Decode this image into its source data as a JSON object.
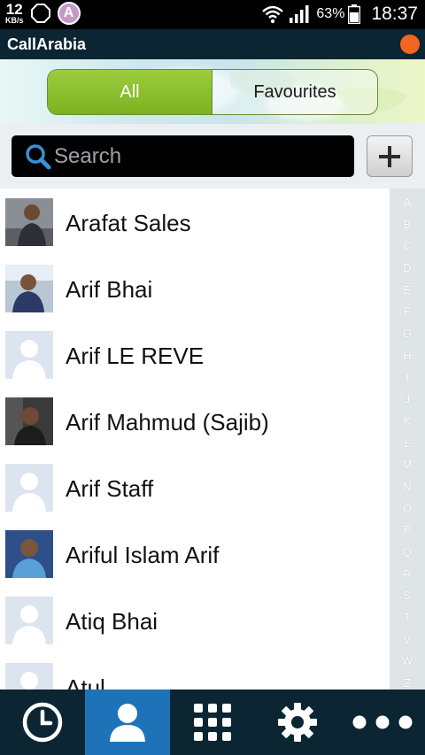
{
  "status_bar": {
    "net_speed_value": "12",
    "net_speed_unit": "KB/s",
    "notification_letter": "A",
    "battery_percent": "63%",
    "time": "18:37"
  },
  "app": {
    "title": "CallArabia"
  },
  "tabs": {
    "all_label": "All",
    "favourites_label": "Favourites",
    "active": "All"
  },
  "search": {
    "placeholder": "Search",
    "value": ""
  },
  "add_button": {
    "icon": "plus-icon"
  },
  "contacts": [
    {
      "name": "Arafat Sales",
      "avatar": "photo"
    },
    {
      "name": "Arif Bhai",
      "avatar": "photo"
    },
    {
      "name": "Arif LE REVE",
      "avatar": "placeholder"
    },
    {
      "name": "Arif Mahmud (Sajib)",
      "avatar": "photo"
    },
    {
      "name": "Arif Staff",
      "avatar": "placeholder"
    },
    {
      "name": "Ariful Islam Arif",
      "avatar": "photo"
    },
    {
      "name": "Atiq Bhai",
      "avatar": "placeholder"
    },
    {
      "name": "Atul",
      "avatar": "placeholder"
    }
  ],
  "alphabet_index": [
    "A",
    "B",
    "C",
    "D",
    "E",
    "F",
    "G",
    "H",
    "I",
    "J",
    "K",
    "L",
    "M",
    "N",
    "O",
    "P",
    "Q",
    "R",
    "S",
    "T",
    "V",
    "W",
    "Z"
  ],
  "bottom_nav": [
    {
      "icon": "clock-icon",
      "active": false
    },
    {
      "icon": "contacts-icon",
      "active": true
    },
    {
      "icon": "dialpad-icon",
      "active": false
    },
    {
      "icon": "gear-icon",
      "active": false
    },
    {
      "icon": "more-icon",
      "active": false
    }
  ],
  "colors": {
    "accent_green": "#8cc13a",
    "active_nav_blue": "#1e73b8",
    "app_bar": "#0c2533",
    "record_dot": "#f26522"
  }
}
